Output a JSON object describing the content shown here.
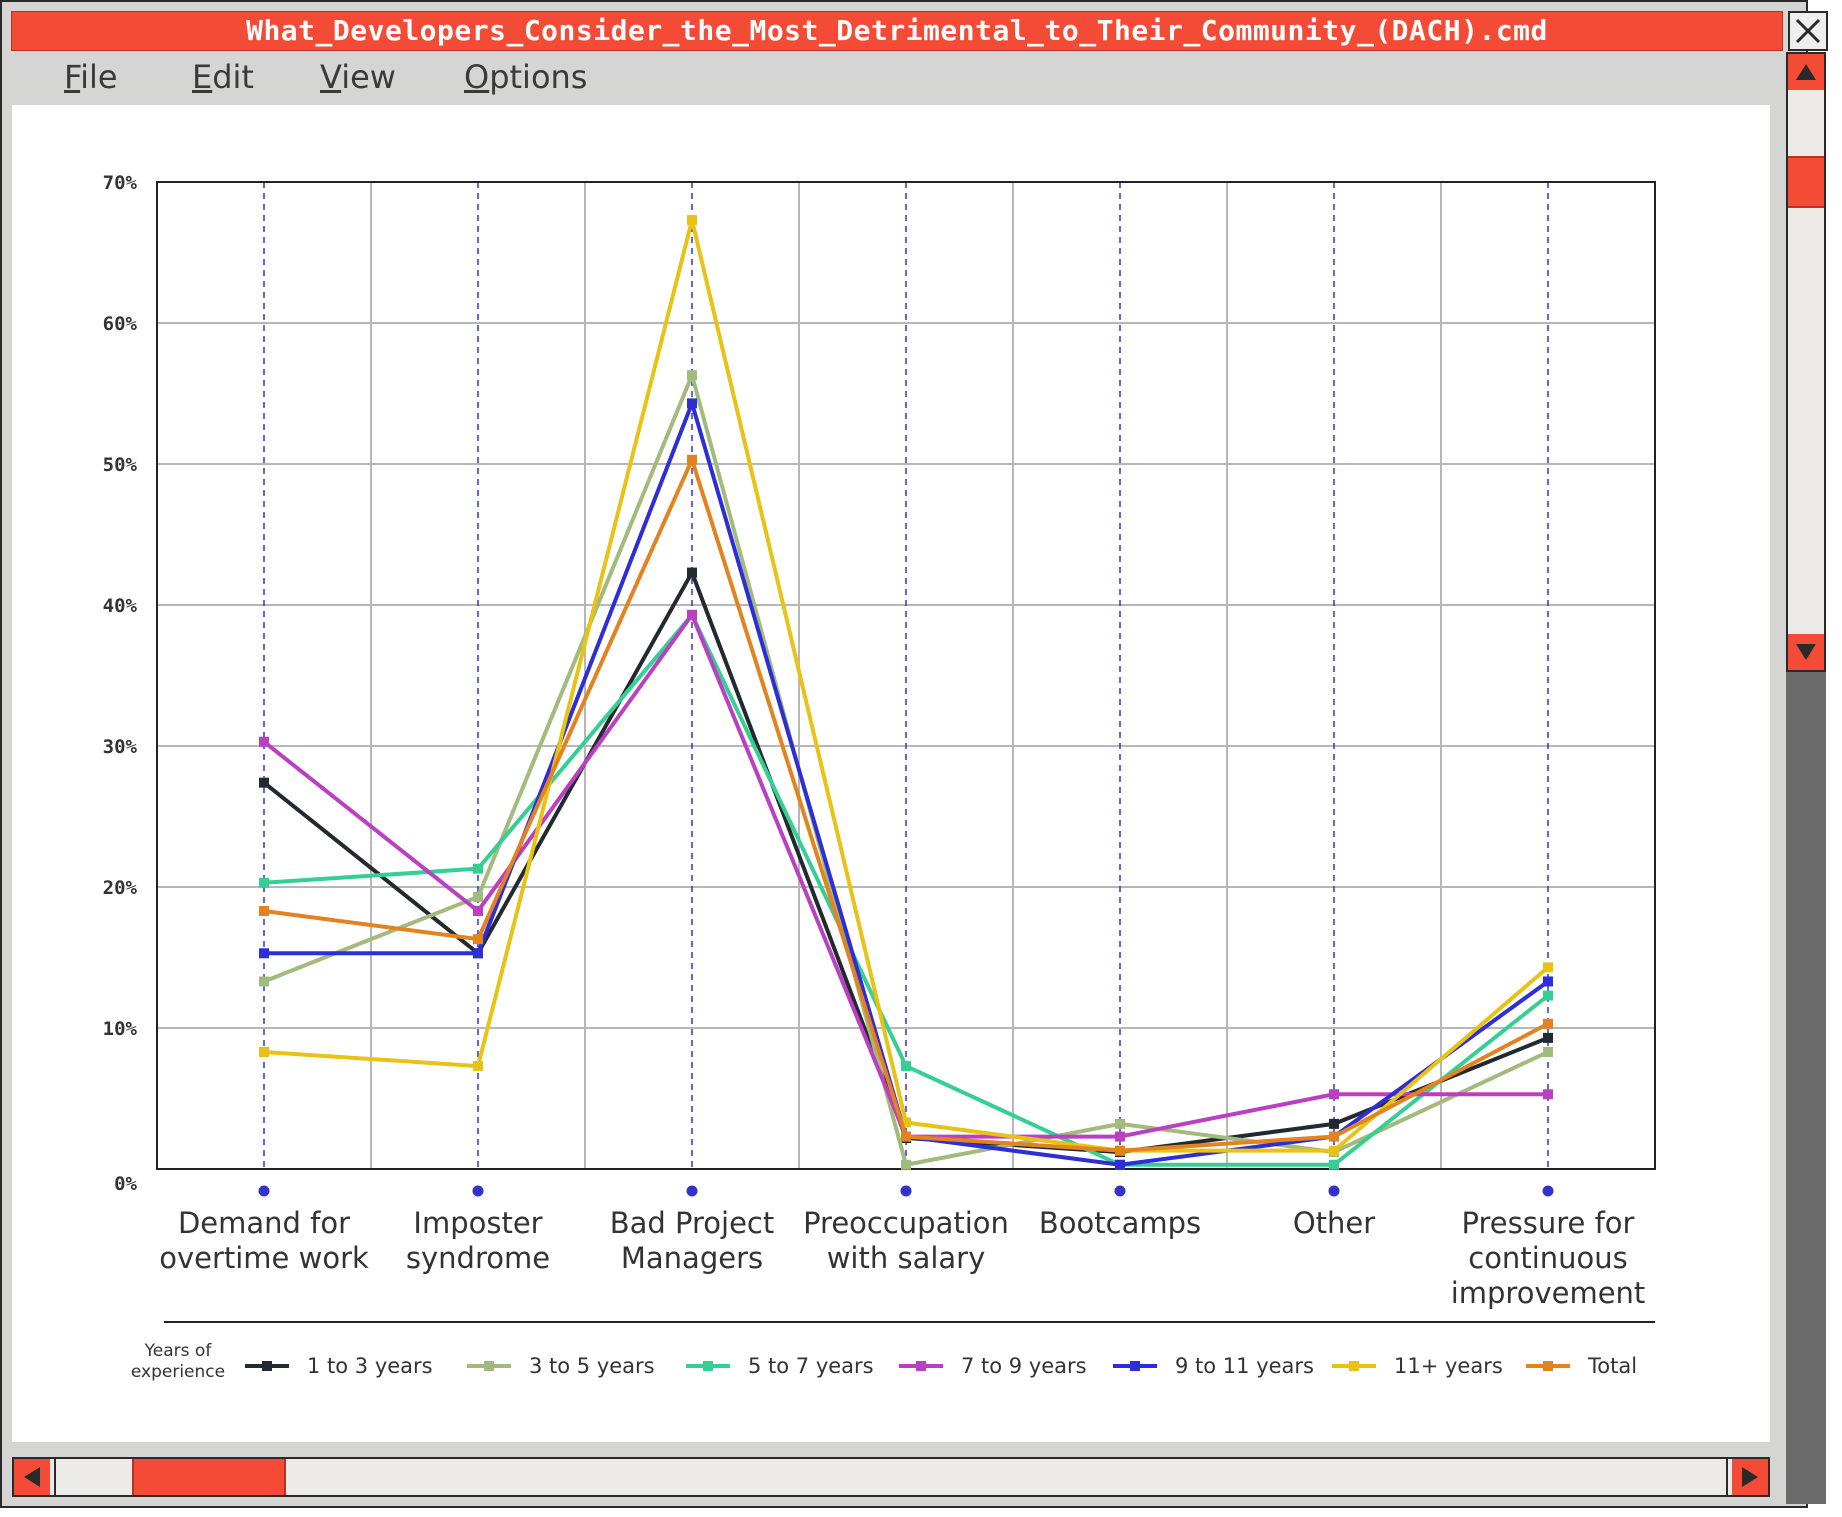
{
  "window": {
    "title": "What_Developers_Consider_the_Most_Detrimental_to_Their_Community_(DACH).cmd"
  },
  "menu": {
    "items": [
      {
        "label": "File",
        "key": "F",
        "rest": "ile"
      },
      {
        "label": "Edit",
        "key": "E",
        "rest": "dit"
      },
      {
        "label": "View",
        "key": "V",
        "rest": "iew"
      },
      {
        "label": "Options",
        "key": "O",
        "rest": "ptions"
      }
    ]
  },
  "colors": {
    "titlebar": "#f44b37",
    "scroll_accent": "#f44b37",
    "x_guides": "#3333cc"
  },
  "chart_data": {
    "type": "line",
    "categories": [
      [
        "Demand for",
        "overtime work"
      ],
      [
        "Imposter",
        "syndrome"
      ],
      [
        "Bad Project",
        "Managers"
      ],
      [
        "Preoccupation",
        "with salary"
      ],
      [
        "Bootcamps"
      ],
      [
        "Other"
      ],
      [
        "Pressure for",
        "continuous",
        "improvement"
      ]
    ],
    "ylim": [
      0,
      70
    ],
    "yticks": [
      0,
      10,
      20,
      30,
      40,
      50,
      60,
      70
    ],
    "ytick_suffix": "%",
    "grid": true,
    "legend_title": [
      "Years of",
      "experience"
    ],
    "legend_position": "bottom",
    "series": [
      {
        "name": "1 to 3 years",
        "color": "#222a2f",
        "values": [
          27.4,
          15.3,
          42.3,
          2.2,
          1.2,
          3.2,
          9.3
        ]
      },
      {
        "name": "3 to 5 years",
        "color": "#a2bb7c",
        "values": [
          13.3,
          19.3,
          56.3,
          0.3,
          3.2,
          1.2,
          8.3
        ]
      },
      {
        "name": "5 to 7 years",
        "color": "#35cf94",
        "values": [
          20.3,
          21.3,
          39.3,
          7.3,
          0.3,
          0.3,
          12.3
        ]
      },
      {
        "name": "7 to 9 years",
        "color": "#bb3fc3",
        "values": [
          30.3,
          18.3,
          39.3,
          2.3,
          2.3,
          5.3,
          5.3
        ]
      },
      {
        "name": "9 to 11 years",
        "color": "#2d2ed8",
        "values": [
          15.3,
          15.3,
          54.3,
          2.3,
          0.3,
          2.3,
          13.3
        ]
      },
      {
        "name": "11+ years",
        "color": "#e8c214",
        "values": [
          8.3,
          7.3,
          67.3,
          3.3,
          1.3,
          1.3,
          14.3
        ]
      },
      {
        "name": "Total",
        "color": "#e2831f",
        "values": [
          18.3,
          16.3,
          50.3,
          2.3,
          1.3,
          2.3,
          10.3
        ]
      }
    ]
  }
}
